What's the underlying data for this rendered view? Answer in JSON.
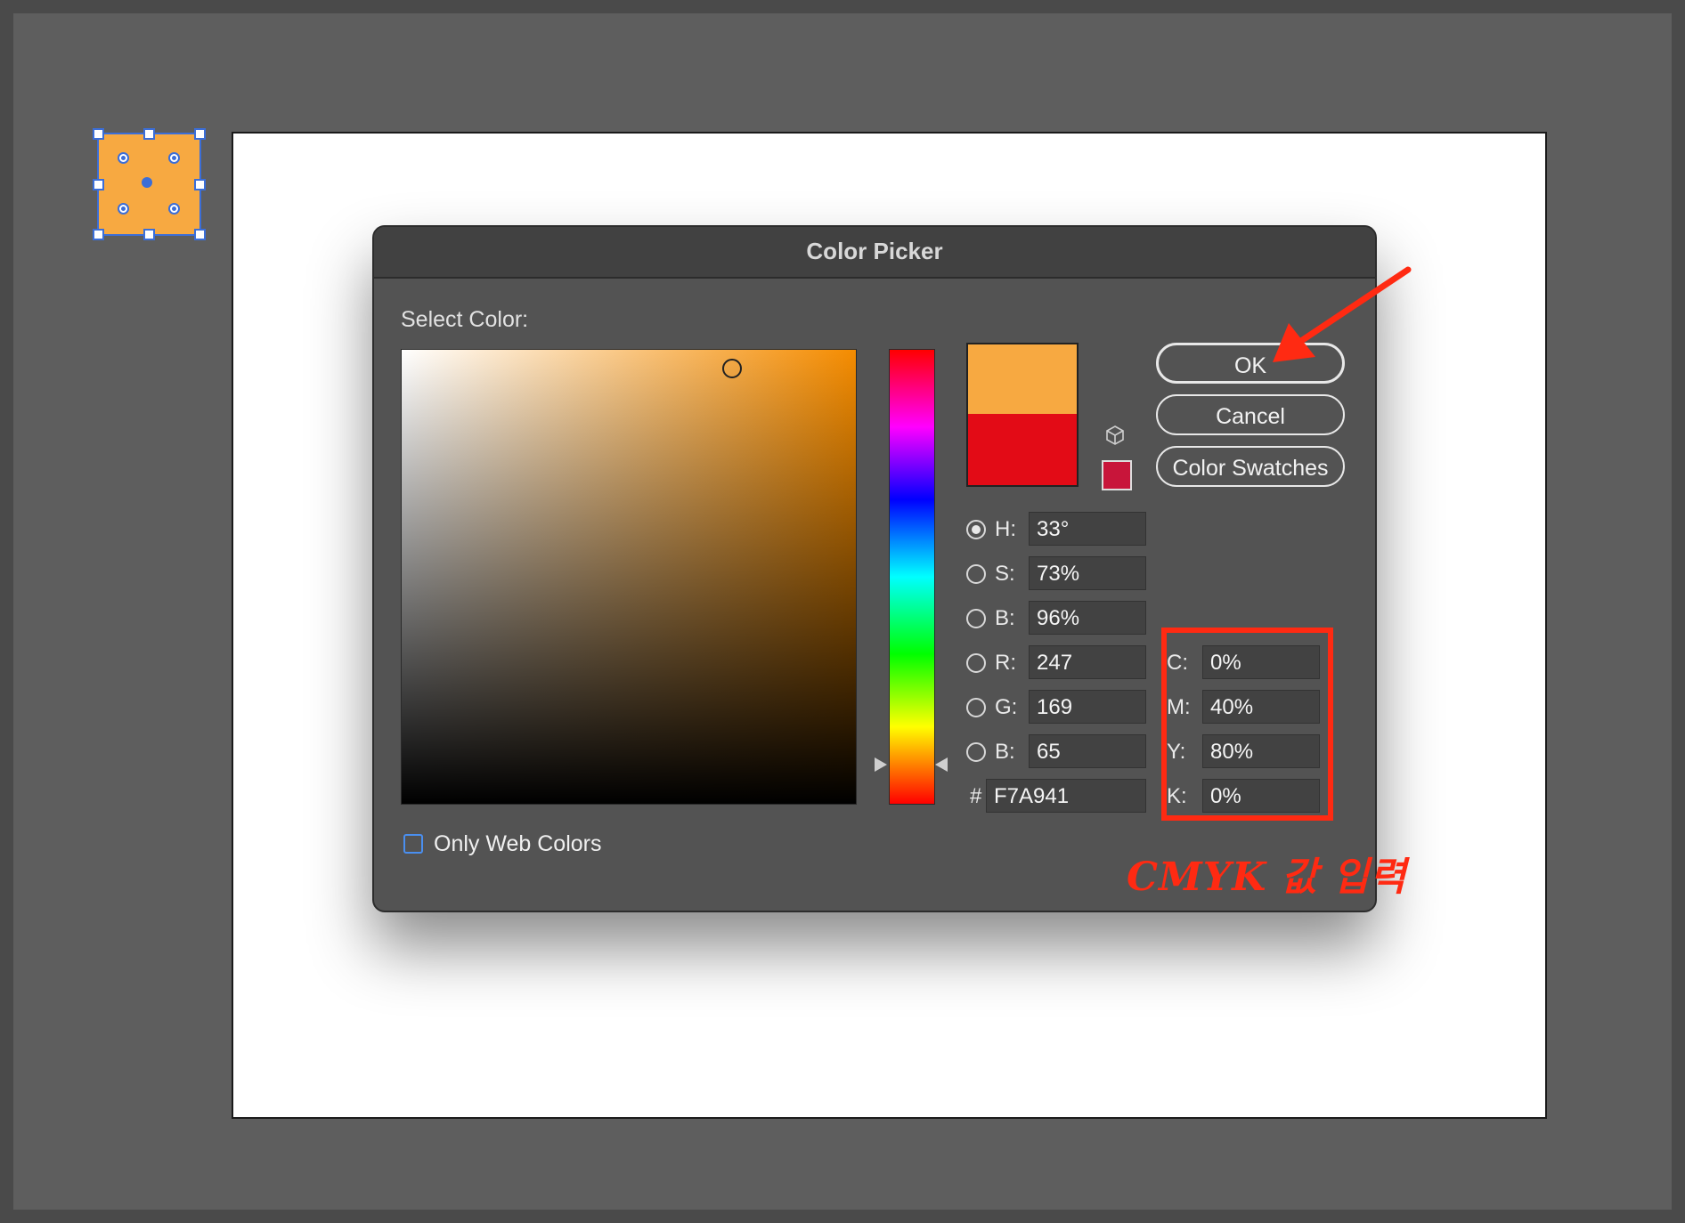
{
  "dialog": {
    "title": "Color Picker",
    "select_color_label": "Select Color:",
    "only_web_colors_label": "Only Web Colors",
    "only_web_colors_checked": false
  },
  "buttons": {
    "ok": "OK",
    "cancel": "Cancel",
    "color_swatches": "Color Swatches"
  },
  "swatches": {
    "new_color": "#f7a941",
    "current_color": "#e30b16",
    "gamut_warning_color": "#c8153a",
    "gamut_icon": "cube-icon"
  },
  "hsb": [
    {
      "label": "H:",
      "value": "33°",
      "selected": true
    },
    {
      "label": "S:",
      "value": "73%",
      "selected": false
    },
    {
      "label": "B:",
      "value": "96%",
      "selected": false
    }
  ],
  "rgb": [
    {
      "label": "R:",
      "value": "247",
      "selected": false
    },
    {
      "label": "G:",
      "value": "169",
      "selected": false
    },
    {
      "label": "B:",
      "value": "65",
      "selected": false
    }
  ],
  "hex": {
    "label": "#",
    "value": "F7A941"
  },
  "cmyk": [
    {
      "label": "C:",
      "value": "0%"
    },
    {
      "label": "M:",
      "value": "40%"
    },
    {
      "label": "Y:",
      "value": "80%"
    },
    {
      "label": "K:",
      "value": "0%"
    }
  ],
  "annotation": {
    "text": "CMYK 값 입력",
    "color": "#ff2a12"
  },
  "canvas": {
    "object_fill": "#f7a941",
    "selection_color": "#3b6ed8"
  }
}
